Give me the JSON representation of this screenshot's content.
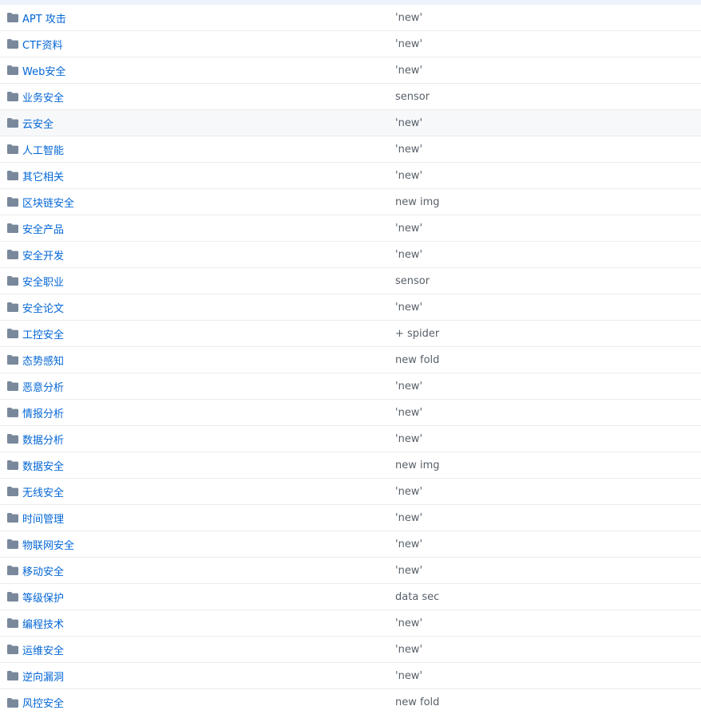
{
  "file_list": {
    "icon": "folder-icon",
    "icon_color": "#79b8ff",
    "rows": [
      {
        "name": "APT 攻击",
        "message": "'new'"
      },
      {
        "name": "CTF资料",
        "message": "'new'"
      },
      {
        "name": "Web安全",
        "message": "'new'"
      },
      {
        "name": "业务安全",
        "message": "sensor"
      },
      {
        "name": "云安全",
        "message": "'new'"
      },
      {
        "name": "人工智能",
        "message": "'new'"
      },
      {
        "name": "其它相关",
        "message": "'new'"
      },
      {
        "name": "区块链安全",
        "message": "new img"
      },
      {
        "name": "安全产品",
        "message": "'new'"
      },
      {
        "name": "安全开发",
        "message": "'new'"
      },
      {
        "name": "安全职业",
        "message": "sensor"
      },
      {
        "name": "安全论文",
        "message": "'new'"
      },
      {
        "name": "工控安全",
        "message": "+ spider"
      },
      {
        "name": "态势感知",
        "message": "new fold"
      },
      {
        "name": "恶意分析",
        "message": "'new'"
      },
      {
        "name": "情报分析",
        "message": "'new'"
      },
      {
        "name": "数据分析",
        "message": "'new'"
      },
      {
        "name": "数据安全",
        "message": "new img"
      },
      {
        "name": "无线安全",
        "message": "'new'"
      },
      {
        "name": "时间管理",
        "message": "'new'"
      },
      {
        "name": "物联网安全",
        "message": "'new'"
      },
      {
        "name": "移动安全",
        "message": "'new'"
      },
      {
        "name": "等级保护",
        "message": "data sec"
      },
      {
        "name": "编程技术",
        "message": "'new'"
      },
      {
        "name": "运维安全",
        "message": "'new'"
      },
      {
        "name": "逆向漏洞",
        "message": "'new'"
      },
      {
        "name": "风控安全",
        "message": "new fold"
      }
    ]
  }
}
